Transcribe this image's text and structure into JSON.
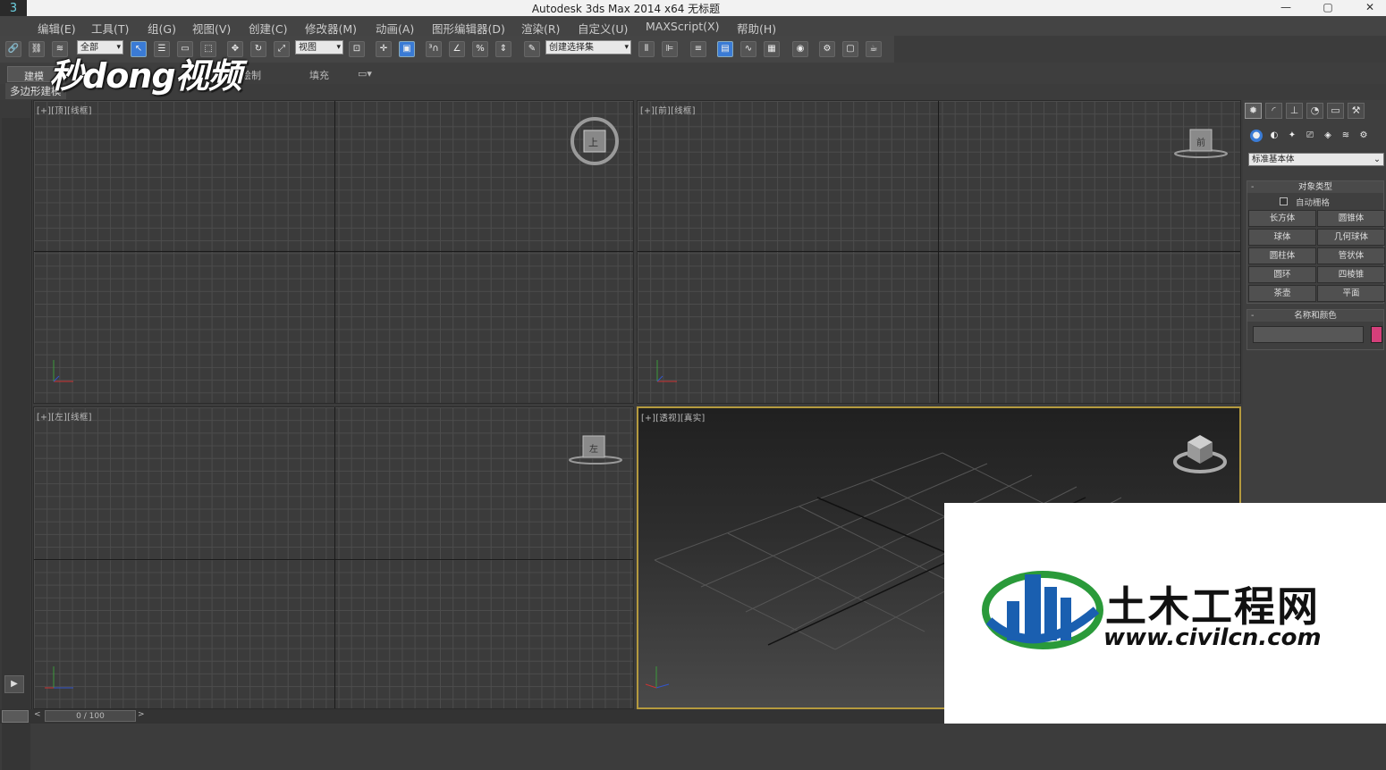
{
  "window": {
    "title": "Autodesk 3ds Max  2014 x64     无标题",
    "minimize": "—",
    "maximize": "▢",
    "close": "✕",
    "app_glyph": "3"
  },
  "menu": [
    "编辑(E)",
    "工具(T)",
    "组(G)",
    "视图(V)",
    "创建(C)",
    "修改器(M)",
    "动画(A)",
    "图形编辑器(D)",
    "渲染(R)",
    "自定义(U)",
    "MAXScript(X)",
    "帮助(H)"
  ],
  "toolbar": {
    "selection_filter": "全部",
    "reference_coord": "视图",
    "named_selection": "创建选择集"
  },
  "ribbon": {
    "tabs": [
      "建模",
      "绘制",
      "填充"
    ],
    "subtab": "多边形建模"
  },
  "viewports": {
    "top": "[+][顶][线框]",
    "front": "[+][前][线框]",
    "left": "[+][左][线框]",
    "perspective": "[+][透视][真实]"
  },
  "viewcube": {
    "top": "上",
    "front": "前",
    "left": "左"
  },
  "command_panel": {
    "category": "标准基本体",
    "object_type_title": "对象类型",
    "autogrid": "自动栅格",
    "buttons": [
      "长方体",
      "圆锥体",
      "球体",
      "几何球体",
      "圆柱体",
      "管状体",
      "圆环",
      "四棱锥",
      "茶壶",
      "平面"
    ],
    "name_color_title": "名称和颜色",
    "color": "#d43f7a"
  },
  "timeline": {
    "frame": "0 / 100"
  },
  "watermarks": {
    "top_left": "秒dong视频",
    "cn": "土木工程网",
    "url": "www.civilcn.com"
  }
}
